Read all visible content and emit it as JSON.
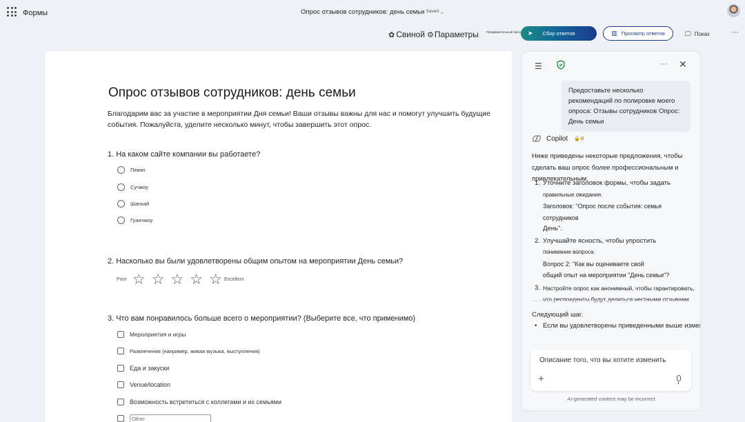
{
  "app": {
    "name": "Формы",
    "doc_title": "Опрос отзывов сотрудников: день семьи",
    "saved_label": "Saved"
  },
  "toolbar": {
    "theme_label": "Свиной",
    "settings_label": "Параметры",
    "preview_small_label": "Предварительный просмотр",
    "collect_label": "Сбор ответов",
    "view_responses_label": "Просмотр ответов",
    "show_label": "Показ"
  },
  "form": {
    "title": "Опрос отзывов сотрудников: день семьи",
    "description": "Благодарим вас за участие в мероприятии Дня семьи! Ваши отзывы важны для нас и помогут улучшить будущие события. Пожалуйста, уделите несколько минут, чтобы завершить этот опрос.",
    "q1": {
      "text": "1. На каком сайте компании вы работаете?",
      "options": [
        "Пекин",
        "Сучжоу",
        "Шанхай",
        "Гуанчжоу"
      ]
    },
    "q2": {
      "text": "2.  Насколько вы были удовлетворены общим опытом на мероприятии День семьи?",
      "low_label": "Poor",
      "high_label": "Excellent",
      "stars_max": 5
    },
    "q3": {
      "text": "3.  Что вам понравилось больше всего о мероприятии? (Выберите все, что применимо)",
      "options": [
        "Мероприятия и игры",
        "Развлечения (например, живая музыка, выступления)",
        "Еда и закуски",
        "Venue/location",
        "Возможность встретиться с коллегами и их семьями"
      ],
      "other_placeholder": "Other"
    }
  },
  "copilot": {
    "user_message": "Предоставьте несколько рекомендаций по полировке моего опроса: Отзывы сотрудников Опрос: День семьи",
    "name": "Copilot",
    "intro": "Ниже приведены некоторые предложения, чтобы сделать ваш опрос более профессиональным и привлекательным.",
    "items": [
      {
        "num": "1.",
        "lines": [
          "Уточните заголовок формы, чтобы задать",
          "правильные ожидания.",
          "Заголовок: \"Опрос после события: семья сотрудников",
          "День\"."
        ]
      },
      {
        "num": "2.",
        "lines": [
          "Улучшайте ясность, чтобы упростить",
          "понимание вопроса.",
          "Вопрос 2: \"Как вы оцениваете свой",
          "общий опыт на мероприятии \"День семьи\"?"
        ]
      },
      {
        "num": "3.",
        "lines": [
          "Настройте опрос как анонимный, чтобы гарантировать,",
          "что респонденты будут делиться честными отзывами."
        ]
      }
    ],
    "next_step_label": "Следующий шаг.",
    "bullet": "Если вы удовлетворены приведенными выше изменениями.",
    "input_placeholder": "Описание того, что вы хотите изменить",
    "disclaimer": "AI-generated content may be incorrect"
  }
}
